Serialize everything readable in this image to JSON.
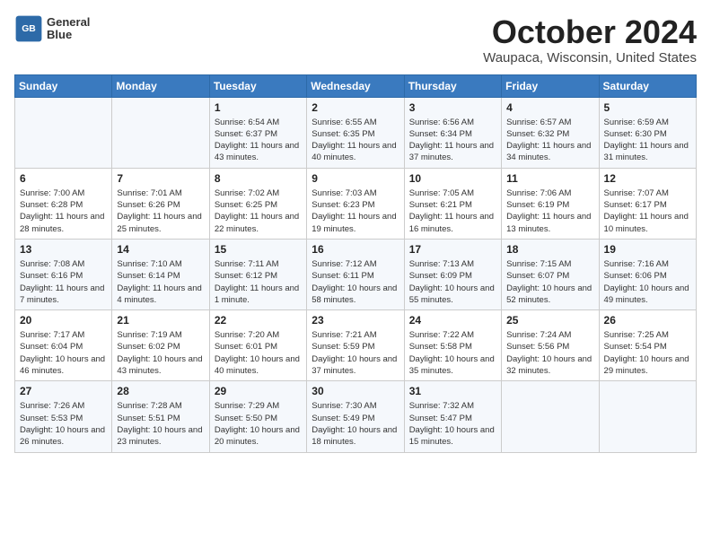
{
  "header": {
    "logo_line1": "General",
    "logo_line2": "Blue",
    "month": "October 2024",
    "location": "Waupaca, Wisconsin, United States"
  },
  "weekdays": [
    "Sunday",
    "Monday",
    "Tuesday",
    "Wednesday",
    "Thursday",
    "Friday",
    "Saturday"
  ],
  "weeks": [
    [
      {
        "day": "",
        "sunrise": "",
        "sunset": "",
        "daylight": ""
      },
      {
        "day": "",
        "sunrise": "",
        "sunset": "",
        "daylight": ""
      },
      {
        "day": "1",
        "sunrise": "Sunrise: 6:54 AM",
        "sunset": "Sunset: 6:37 PM",
        "daylight": "Daylight: 11 hours and 43 minutes."
      },
      {
        "day": "2",
        "sunrise": "Sunrise: 6:55 AM",
        "sunset": "Sunset: 6:35 PM",
        "daylight": "Daylight: 11 hours and 40 minutes."
      },
      {
        "day": "3",
        "sunrise": "Sunrise: 6:56 AM",
        "sunset": "Sunset: 6:34 PM",
        "daylight": "Daylight: 11 hours and 37 minutes."
      },
      {
        "day": "4",
        "sunrise": "Sunrise: 6:57 AM",
        "sunset": "Sunset: 6:32 PM",
        "daylight": "Daylight: 11 hours and 34 minutes."
      },
      {
        "day": "5",
        "sunrise": "Sunrise: 6:59 AM",
        "sunset": "Sunset: 6:30 PM",
        "daylight": "Daylight: 11 hours and 31 minutes."
      }
    ],
    [
      {
        "day": "6",
        "sunrise": "Sunrise: 7:00 AM",
        "sunset": "Sunset: 6:28 PM",
        "daylight": "Daylight: 11 hours and 28 minutes."
      },
      {
        "day": "7",
        "sunrise": "Sunrise: 7:01 AM",
        "sunset": "Sunset: 6:26 PM",
        "daylight": "Daylight: 11 hours and 25 minutes."
      },
      {
        "day": "8",
        "sunrise": "Sunrise: 7:02 AM",
        "sunset": "Sunset: 6:25 PM",
        "daylight": "Daylight: 11 hours and 22 minutes."
      },
      {
        "day": "9",
        "sunrise": "Sunrise: 7:03 AM",
        "sunset": "Sunset: 6:23 PM",
        "daylight": "Daylight: 11 hours and 19 minutes."
      },
      {
        "day": "10",
        "sunrise": "Sunrise: 7:05 AM",
        "sunset": "Sunset: 6:21 PM",
        "daylight": "Daylight: 11 hours and 16 minutes."
      },
      {
        "day": "11",
        "sunrise": "Sunrise: 7:06 AM",
        "sunset": "Sunset: 6:19 PM",
        "daylight": "Daylight: 11 hours and 13 minutes."
      },
      {
        "day": "12",
        "sunrise": "Sunrise: 7:07 AM",
        "sunset": "Sunset: 6:17 PM",
        "daylight": "Daylight: 11 hours and 10 minutes."
      }
    ],
    [
      {
        "day": "13",
        "sunrise": "Sunrise: 7:08 AM",
        "sunset": "Sunset: 6:16 PM",
        "daylight": "Daylight: 11 hours and 7 minutes."
      },
      {
        "day": "14",
        "sunrise": "Sunrise: 7:10 AM",
        "sunset": "Sunset: 6:14 PM",
        "daylight": "Daylight: 11 hours and 4 minutes."
      },
      {
        "day": "15",
        "sunrise": "Sunrise: 7:11 AM",
        "sunset": "Sunset: 6:12 PM",
        "daylight": "Daylight: 11 hours and 1 minute."
      },
      {
        "day": "16",
        "sunrise": "Sunrise: 7:12 AM",
        "sunset": "Sunset: 6:11 PM",
        "daylight": "Daylight: 10 hours and 58 minutes."
      },
      {
        "day": "17",
        "sunrise": "Sunrise: 7:13 AM",
        "sunset": "Sunset: 6:09 PM",
        "daylight": "Daylight: 10 hours and 55 minutes."
      },
      {
        "day": "18",
        "sunrise": "Sunrise: 7:15 AM",
        "sunset": "Sunset: 6:07 PM",
        "daylight": "Daylight: 10 hours and 52 minutes."
      },
      {
        "day": "19",
        "sunrise": "Sunrise: 7:16 AM",
        "sunset": "Sunset: 6:06 PM",
        "daylight": "Daylight: 10 hours and 49 minutes."
      }
    ],
    [
      {
        "day": "20",
        "sunrise": "Sunrise: 7:17 AM",
        "sunset": "Sunset: 6:04 PM",
        "daylight": "Daylight: 10 hours and 46 minutes."
      },
      {
        "day": "21",
        "sunrise": "Sunrise: 7:19 AM",
        "sunset": "Sunset: 6:02 PM",
        "daylight": "Daylight: 10 hours and 43 minutes."
      },
      {
        "day": "22",
        "sunrise": "Sunrise: 7:20 AM",
        "sunset": "Sunset: 6:01 PM",
        "daylight": "Daylight: 10 hours and 40 minutes."
      },
      {
        "day": "23",
        "sunrise": "Sunrise: 7:21 AM",
        "sunset": "Sunset: 5:59 PM",
        "daylight": "Daylight: 10 hours and 37 minutes."
      },
      {
        "day": "24",
        "sunrise": "Sunrise: 7:22 AM",
        "sunset": "Sunset: 5:58 PM",
        "daylight": "Daylight: 10 hours and 35 minutes."
      },
      {
        "day": "25",
        "sunrise": "Sunrise: 7:24 AM",
        "sunset": "Sunset: 5:56 PM",
        "daylight": "Daylight: 10 hours and 32 minutes."
      },
      {
        "day": "26",
        "sunrise": "Sunrise: 7:25 AM",
        "sunset": "Sunset: 5:54 PM",
        "daylight": "Daylight: 10 hours and 29 minutes."
      }
    ],
    [
      {
        "day": "27",
        "sunrise": "Sunrise: 7:26 AM",
        "sunset": "Sunset: 5:53 PM",
        "daylight": "Daylight: 10 hours and 26 minutes."
      },
      {
        "day": "28",
        "sunrise": "Sunrise: 7:28 AM",
        "sunset": "Sunset: 5:51 PM",
        "daylight": "Daylight: 10 hours and 23 minutes."
      },
      {
        "day": "29",
        "sunrise": "Sunrise: 7:29 AM",
        "sunset": "Sunset: 5:50 PM",
        "daylight": "Daylight: 10 hours and 20 minutes."
      },
      {
        "day": "30",
        "sunrise": "Sunrise: 7:30 AM",
        "sunset": "Sunset: 5:49 PM",
        "daylight": "Daylight: 10 hours and 18 minutes."
      },
      {
        "day": "31",
        "sunrise": "Sunrise: 7:32 AM",
        "sunset": "Sunset: 5:47 PM",
        "daylight": "Daylight: 10 hours and 15 minutes."
      },
      {
        "day": "",
        "sunrise": "",
        "sunset": "",
        "daylight": ""
      },
      {
        "day": "",
        "sunrise": "",
        "sunset": "",
        "daylight": ""
      }
    ]
  ]
}
